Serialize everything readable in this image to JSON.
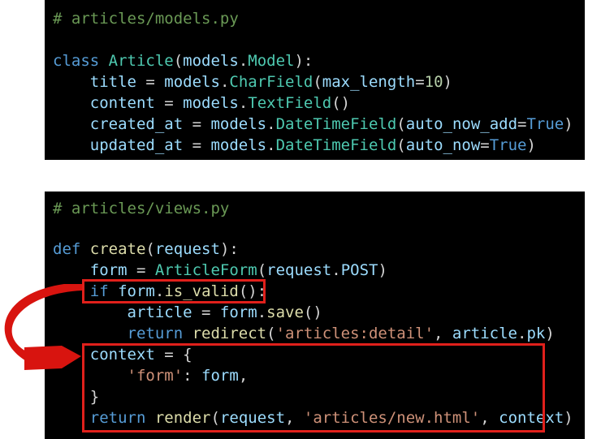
{
  "models": {
    "comment": "# articles/models.py",
    "lines": [
      [
        {
          "t": "class ",
          "c": "kw"
        },
        {
          "t": "Article",
          "c": "cls"
        },
        {
          "t": "(",
          "c": "pl"
        },
        {
          "t": "models",
          "c": "var"
        },
        {
          "t": ".",
          "c": "pl"
        },
        {
          "t": "Model",
          "c": "cls"
        },
        {
          "t": "):",
          "c": "pl"
        }
      ],
      [
        {
          "t": "    ",
          "c": "pl"
        },
        {
          "t": "title",
          "c": "var"
        },
        {
          "t": " = ",
          "c": "pl"
        },
        {
          "t": "models",
          "c": "var"
        },
        {
          "t": ".",
          "c": "pl"
        },
        {
          "t": "CharField",
          "c": "cls"
        },
        {
          "t": "(",
          "c": "pl"
        },
        {
          "t": "max_length",
          "c": "var"
        },
        {
          "t": "=",
          "c": "pl"
        },
        {
          "t": "10",
          "c": "num"
        },
        {
          "t": ")",
          "c": "pl"
        }
      ],
      [
        {
          "t": "    ",
          "c": "pl"
        },
        {
          "t": "content",
          "c": "var"
        },
        {
          "t": " = ",
          "c": "pl"
        },
        {
          "t": "models",
          "c": "var"
        },
        {
          "t": ".",
          "c": "pl"
        },
        {
          "t": "TextField",
          "c": "cls"
        },
        {
          "t": "()",
          "c": "pl"
        }
      ],
      [
        {
          "t": "    ",
          "c": "pl"
        },
        {
          "t": "created_at",
          "c": "var"
        },
        {
          "t": " = ",
          "c": "pl"
        },
        {
          "t": "models",
          "c": "var"
        },
        {
          "t": ".",
          "c": "pl"
        },
        {
          "t": "DateTimeField",
          "c": "cls"
        },
        {
          "t": "(",
          "c": "pl"
        },
        {
          "t": "auto_now_add",
          "c": "var"
        },
        {
          "t": "=",
          "c": "pl"
        },
        {
          "t": "True",
          "c": "kw"
        },
        {
          "t": ")",
          "c": "pl"
        }
      ],
      [
        {
          "t": "    ",
          "c": "pl"
        },
        {
          "t": "updated_at",
          "c": "var"
        },
        {
          "t": " = ",
          "c": "pl"
        },
        {
          "t": "models",
          "c": "var"
        },
        {
          "t": ".",
          "c": "pl"
        },
        {
          "t": "DateTimeField",
          "c": "cls"
        },
        {
          "t": "(",
          "c": "pl"
        },
        {
          "t": "auto_now",
          "c": "var"
        },
        {
          "t": "=",
          "c": "pl"
        },
        {
          "t": "True",
          "c": "kw"
        },
        {
          "t": ")",
          "c": "pl"
        }
      ]
    ]
  },
  "views": {
    "comment": "# articles/views.py",
    "lines": [
      [
        {
          "t": "def ",
          "c": "kw"
        },
        {
          "t": "create",
          "c": "fn"
        },
        {
          "t": "(",
          "c": "pl"
        },
        {
          "t": "request",
          "c": "var"
        },
        {
          "t": "):",
          "c": "pl"
        }
      ],
      [
        {
          "t": "    ",
          "c": "pl"
        },
        {
          "t": "form",
          "c": "var"
        },
        {
          "t": " = ",
          "c": "pl"
        },
        {
          "t": "ArticleForm",
          "c": "cls"
        },
        {
          "t": "(",
          "c": "pl"
        },
        {
          "t": "request",
          "c": "var"
        },
        {
          "t": ".",
          "c": "pl"
        },
        {
          "t": "POST",
          "c": "var"
        },
        {
          "t": ")",
          "c": "pl"
        }
      ],
      [
        {
          "t": "    ",
          "c": "pl"
        },
        {
          "t": "if ",
          "c": "kw"
        },
        {
          "t": "form",
          "c": "var"
        },
        {
          "t": ".",
          "c": "pl"
        },
        {
          "t": "is_valid",
          "c": "fn"
        },
        {
          "t": "():",
          "c": "pl"
        }
      ],
      [
        {
          "t": "        ",
          "c": "pl"
        },
        {
          "t": "article",
          "c": "var"
        },
        {
          "t": " = ",
          "c": "pl"
        },
        {
          "t": "form",
          "c": "var"
        },
        {
          "t": ".",
          "c": "pl"
        },
        {
          "t": "save",
          "c": "fn"
        },
        {
          "t": "()",
          "c": "pl"
        }
      ],
      [
        {
          "t": "        ",
          "c": "pl"
        },
        {
          "t": "return ",
          "c": "kw"
        },
        {
          "t": "redirect",
          "c": "fn"
        },
        {
          "t": "(",
          "c": "pl"
        },
        {
          "t": "'articles:detail'",
          "c": "str"
        },
        {
          "t": ", ",
          "c": "pl"
        },
        {
          "t": "article",
          "c": "var"
        },
        {
          "t": ".",
          "c": "pl"
        },
        {
          "t": "pk",
          "c": "var"
        },
        {
          "t": ")",
          "c": "pl"
        }
      ],
      [
        {
          "t": "    ",
          "c": "pl"
        },
        {
          "t": "context",
          "c": "var"
        },
        {
          "t": " = {",
          "c": "pl"
        }
      ],
      [
        {
          "t": "        ",
          "c": "pl"
        },
        {
          "t": "'form'",
          "c": "str"
        },
        {
          "t": ": ",
          "c": "pl"
        },
        {
          "t": "form",
          "c": "var"
        },
        {
          "t": ",",
          "c": "pl"
        }
      ],
      [
        {
          "t": "    }",
          "c": "pl"
        }
      ],
      [
        {
          "t": "    ",
          "c": "pl"
        },
        {
          "t": "return ",
          "c": "kw"
        },
        {
          "t": "render",
          "c": "fn"
        },
        {
          "t": "(",
          "c": "pl"
        },
        {
          "t": "request",
          "c": "var"
        },
        {
          "t": ", ",
          "c": "pl"
        },
        {
          "t": "'articles/new.html'",
          "c": "str"
        },
        {
          "t": ", ",
          "c": "pl"
        },
        {
          "t": "context",
          "c": "var"
        },
        {
          "t": ")",
          "c": "pl"
        }
      ]
    ]
  },
  "colors": {
    "highlight_box": "#e0201b",
    "arrow": "#d8140f"
  }
}
